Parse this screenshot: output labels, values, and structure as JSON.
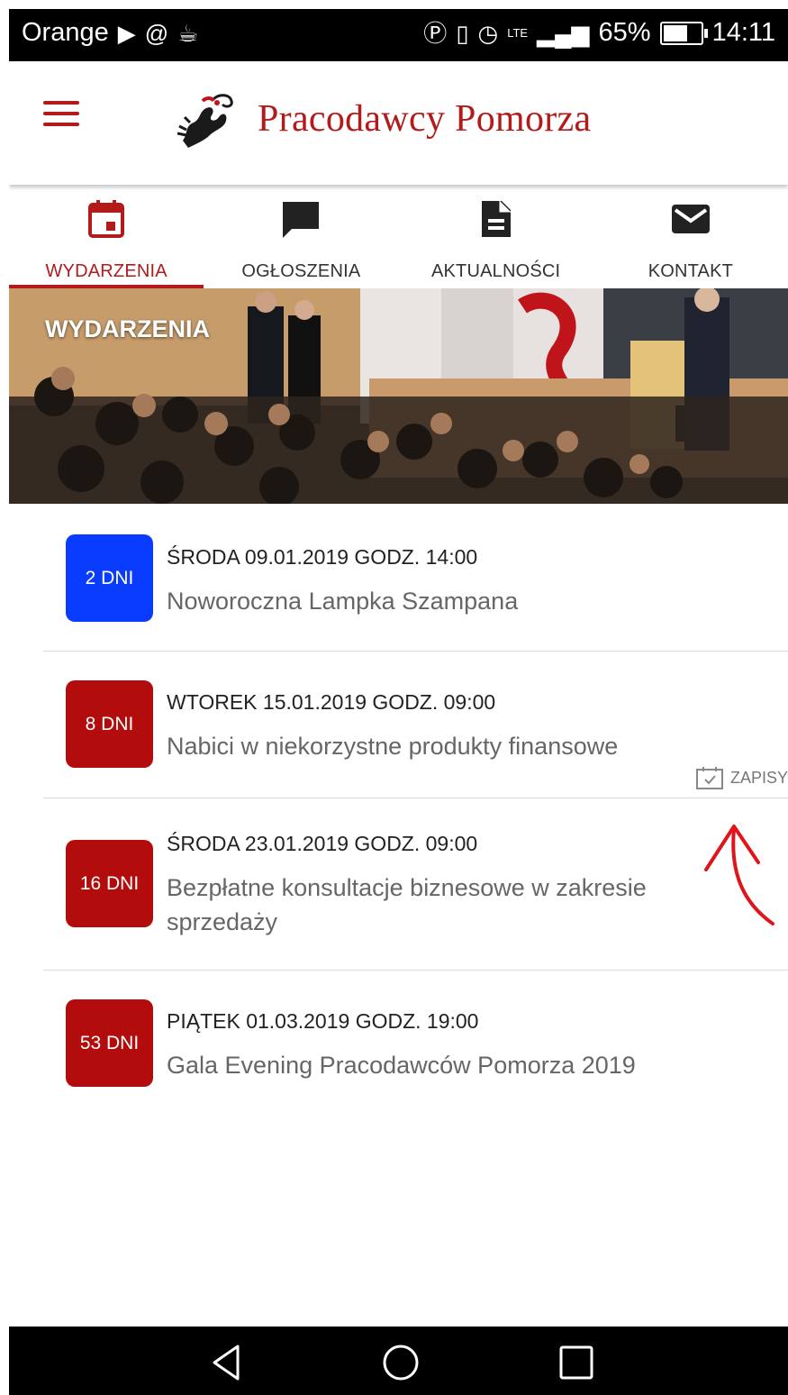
{
  "status_bar": {
    "carrier": "Orange",
    "battery": "65%",
    "network": "LTE",
    "time": "14:11"
  },
  "header": {
    "app_title": "Pracodawcy Pomorza",
    "brand_color": "#b31b1b"
  },
  "tabs": [
    {
      "label": "WYDARZENIA",
      "icon": "calendar-icon",
      "active": true
    },
    {
      "label": "OGŁOSZENIA",
      "icon": "chat-bubble-icon",
      "active": false
    },
    {
      "label": "AKTUALNOŚCI",
      "icon": "document-icon",
      "active": false
    },
    {
      "label": "KONTAKT",
      "icon": "envelope-icon",
      "active": false
    }
  ],
  "hero": {
    "title": "WYDARZENIA"
  },
  "events": [
    {
      "days": "2 DNI",
      "badge_color": "#0a3cff",
      "date": "ŚRODA 09.01.2019 GODZ. 14:00",
      "title": "Noworoczna Lampka Szampana"
    },
    {
      "days": "8 DNI",
      "badge_color": "#b30c0c",
      "date": "WTOREK 15.01.2019 GODZ. 09:00",
      "title": "Nabici w niekorzystne produkty finansowe",
      "action": "ZAPISY"
    },
    {
      "days": "16 DNI",
      "badge_color": "#b30c0c",
      "date": "ŚRODA 23.01.2019 GODZ. 09:00",
      "title": "Bezpłatne konsultacje biznesowe w zakresie sprzedaży"
    },
    {
      "days": "53 DNI",
      "badge_color": "#b30c0c",
      "date": "PIĄTEK 01.03.2019 GODZ. 19:00",
      "title": "Gala Evening Pracodawców Pomorza 2019"
    }
  ],
  "nav_bar": {
    "buttons": [
      "back-icon",
      "home-icon",
      "recents-icon"
    ]
  }
}
